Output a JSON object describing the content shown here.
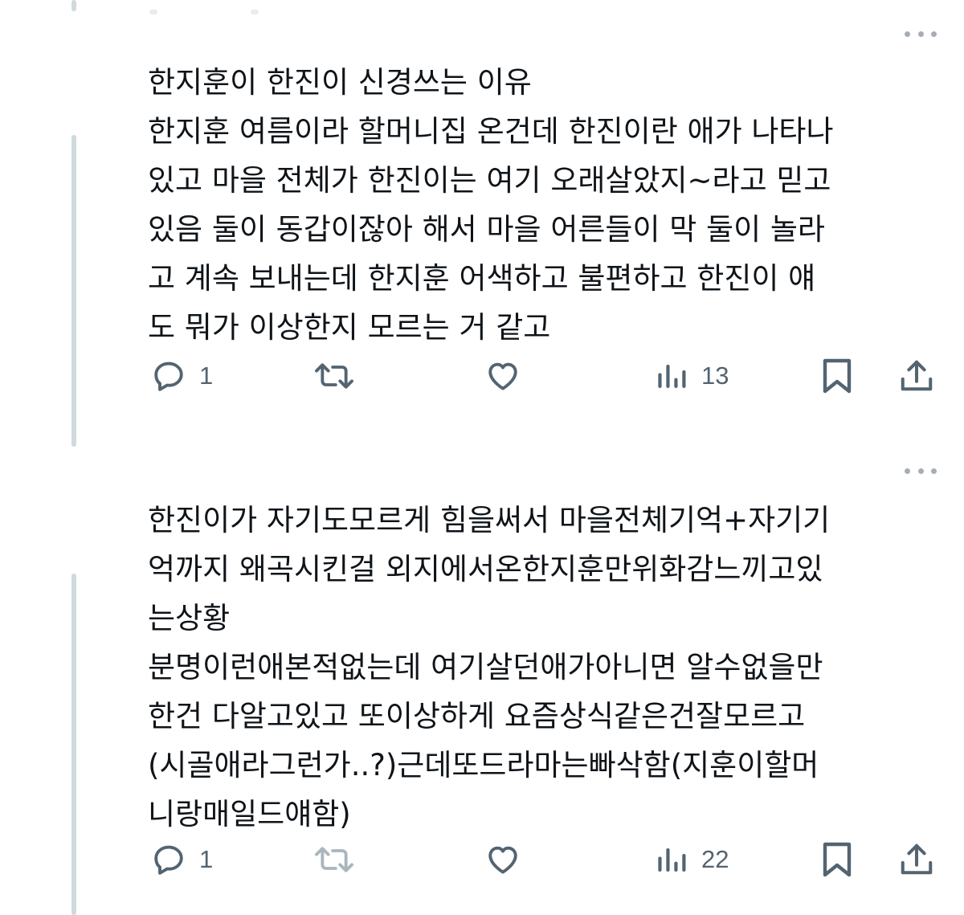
{
  "tweets": [
    {
      "text": "한지훈이 한진이 신경쓰는 이유\n한지훈 여름이라 할머니집 온건데 한진이란 애가 나타나\n있고 마을 전체가 한진이는 여기 오래살았지~라고 믿고\n있음 둘이 동갑이잖아 해서 마을 어른들이 막 둘이 놀라\n고 계속 보내는데 한지훈 어색하고 불편하고 한진이 얘\n도 뭐가 이상한지 모르는 거 같고",
      "reply_count": "1",
      "retweet_count": "",
      "like_count": "",
      "view_count": "13"
    },
    {
      "text": "한진이가 자기도모르게 힘을써서 마을전체기억+자기기\n억까지 왜곡시킨걸 외지에서온한지훈만위화감느끼고있\n는상황\n분명이런애본적없는데 여기살던애가아니면 알수없을만\n한건 다알고있고 또이상하게 요즘상식같은건잘모르고\n(시골애라그런가..?)근데또드라마는빠삭함(지훈이할머\n니랑매일드얘함)",
      "reply_count": "1",
      "retweet_count": "",
      "like_count": "",
      "view_count": "22"
    }
  ],
  "colors": {
    "icon": "#536471",
    "icon_light": "#aab6be",
    "thread_line": "#cfd9de",
    "text": "#0f1419"
  },
  "icons": [
    "reply-icon",
    "retweet-icon",
    "like-icon",
    "views-icon",
    "bookmark-icon",
    "share-icon",
    "more-icon"
  ]
}
